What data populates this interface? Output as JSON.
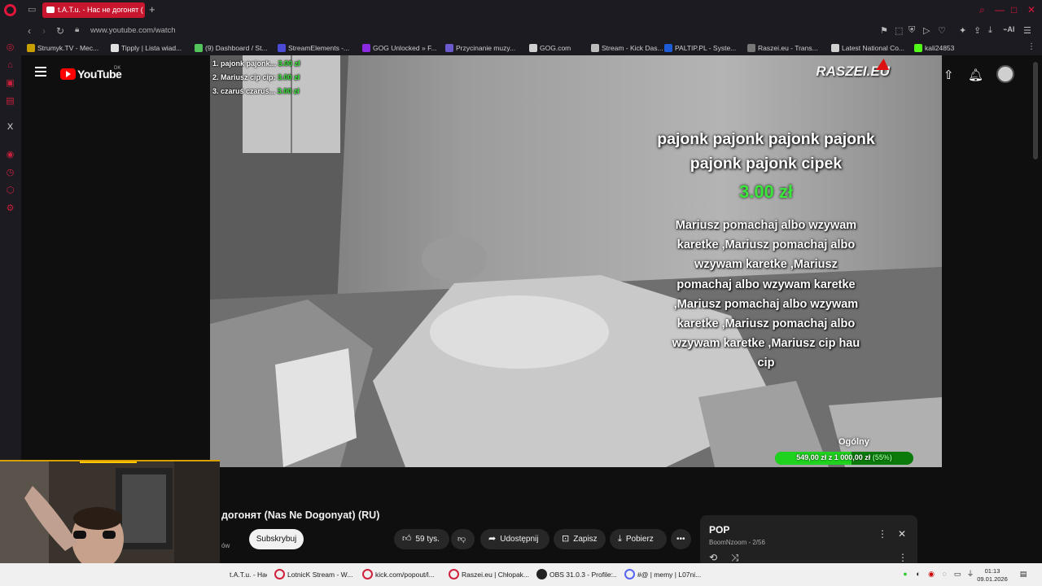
{
  "browser": {
    "tab_title": "t.A.T.u. - Нас не догонят (",
    "url": "www.youtube.com/watch",
    "bookmarks": [
      {
        "label": "Strumyk.TV - Mec...",
        "color": "#c7a000"
      },
      {
        "label": "Tipply | Lista wiad...",
        "color": "#e0e0e0"
      },
      {
        "label": "(9) Dashboard / St...",
        "color": "#53c45b"
      },
      {
        "label": "StreamElements -...",
        "color": "#4b4bd6"
      },
      {
        "label": "GOG Unlocked » F...",
        "color": "#8a2be2"
      },
      {
        "label": "Przycinanie muzy...",
        "color": "#6a5acd"
      },
      {
        "label": "GOG.com",
        "color": "#cfcfcf"
      },
      {
        "label": "Stream - Kick Das...",
        "color": "#bdbdbd"
      },
      {
        "label": "PALTIP.PL - Syste...",
        "color": "#1e5bd6"
      },
      {
        "label": "Raszei.eu - Trans...",
        "color": "#777777"
      },
      {
        "label": "Latest National Co...",
        "color": "#d0d0d0"
      },
      {
        "label": "kali24853",
        "color": "#53fc18"
      }
    ]
  },
  "youtube": {
    "logo_text": "YouTube",
    "region": "DK",
    "video_title": "догонят (Nas Ne Dogonyat) (RU)",
    "subs_fragment": "ów",
    "subscribe_label": "Subskrybuj",
    "likes": "59 tys.",
    "share_label": "Udostępnij",
    "save_label": "Zapisz",
    "download_label": "Pobierz"
  },
  "overlay": {
    "leaderboard": [
      {
        "name": "1. pajonk pajonk...",
        "amount": "3.00 zł"
      },
      {
        "name": "2. Mariusz cip cip:",
        "amount": "3.00 zł"
      },
      {
        "name": "3. czaruś czaruś...",
        "amount": "3.00 zł"
      }
    ],
    "brand": "RASZEI.EU",
    "donor_name": "pajonk pajonk pajonk pajonk pajonk pajonk cipek",
    "donation_amount": "3.00 zł",
    "donation_message": "Mariusz pomachaj albo wzywam karetke ,Mariusz pomachaj albo wzywam karetke ,Mariusz pomachaj albo wzywam karetke ,Mariusz pomachaj albo wzywam karetke ,Mariusz pomachaj albo wzywam karetke ,Mariusz cip hau cip",
    "goal_label": "Ogólny",
    "goal_text": "549,00 zł z 1 000,00 zł",
    "goal_percent_text": "(55%)",
    "goal_fraction": 0.55
  },
  "playlist": {
    "title": "POP",
    "subtitle": "BoomNzoom - 2/56"
  },
  "taskbar": {
    "items": [
      "t.A.T.u. - Нас не до...",
      "LotnicK Stream - W...",
      "kick.com/popout/l...",
      "Raszei.eu | Chłopak...",
      "OBS 31.0.3 - Profile:...",
      "#@ | memy | L07ni..."
    ],
    "time": "01:13",
    "date": "09.01.2026"
  }
}
